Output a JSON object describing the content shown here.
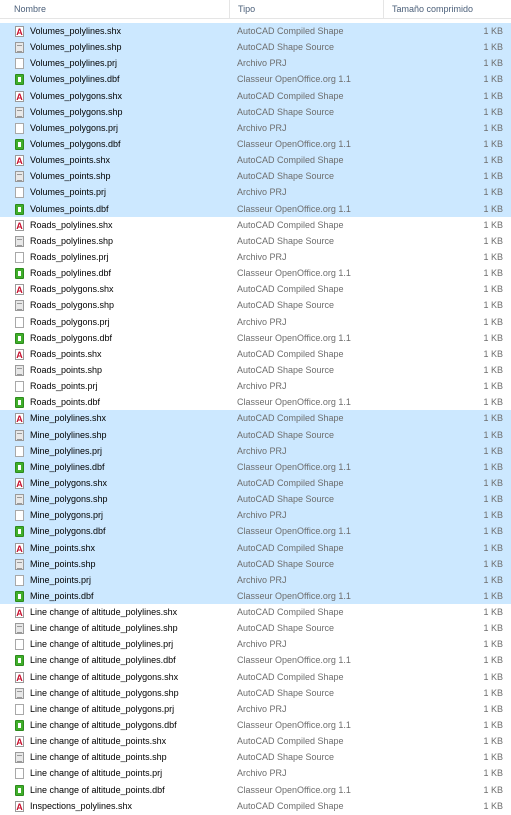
{
  "columns": {
    "name": "Nombre",
    "type": "Tipo",
    "size": "Tamaño comprimido"
  },
  "files": [
    {
      "name": "Volumes_polylines.shx",
      "type": "AutoCAD Compiled Shape",
      "size": "1 KB",
      "icon": "shx",
      "selected": true
    },
    {
      "name": "Volumes_polylines.shp",
      "type": "AutoCAD Shape Source",
      "size": "1 KB",
      "icon": "shp",
      "selected": true
    },
    {
      "name": "Volumes_polylines.prj",
      "type": "Archivo PRJ",
      "size": "1 KB",
      "icon": "prj",
      "selected": true
    },
    {
      "name": "Volumes_polylines.dbf",
      "type": "Classeur OpenOffice.org 1.1",
      "size": "1 KB",
      "icon": "dbf",
      "selected": true
    },
    {
      "name": "Volumes_polygons.shx",
      "type": "AutoCAD Compiled Shape",
      "size": "1 KB",
      "icon": "shx",
      "selected": true
    },
    {
      "name": "Volumes_polygons.shp",
      "type": "AutoCAD Shape Source",
      "size": "1 KB",
      "icon": "shp",
      "selected": true
    },
    {
      "name": "Volumes_polygons.prj",
      "type": "Archivo PRJ",
      "size": "1 KB",
      "icon": "prj",
      "selected": true
    },
    {
      "name": "Volumes_polygons.dbf",
      "type": "Classeur OpenOffice.org 1.1",
      "size": "1 KB",
      "icon": "dbf",
      "selected": true
    },
    {
      "name": "Volumes_points.shx",
      "type": "AutoCAD Compiled Shape",
      "size": "1 KB",
      "icon": "shx",
      "selected": true
    },
    {
      "name": "Volumes_points.shp",
      "type": "AutoCAD Shape Source",
      "size": "1 KB",
      "icon": "shp",
      "selected": true
    },
    {
      "name": "Volumes_points.prj",
      "type": "Archivo PRJ",
      "size": "1 KB",
      "icon": "prj",
      "selected": true
    },
    {
      "name": "Volumes_points.dbf",
      "type": "Classeur OpenOffice.org 1.1",
      "size": "1 KB",
      "icon": "dbf",
      "selected": true
    },
    {
      "name": "Roads_polylines.shx",
      "type": "AutoCAD Compiled Shape",
      "size": "1 KB",
      "icon": "shx",
      "selected": false
    },
    {
      "name": "Roads_polylines.shp",
      "type": "AutoCAD Shape Source",
      "size": "1 KB",
      "icon": "shp",
      "selected": false
    },
    {
      "name": "Roads_polylines.prj",
      "type": "Archivo PRJ",
      "size": "1 KB",
      "icon": "prj",
      "selected": false
    },
    {
      "name": "Roads_polylines.dbf",
      "type": "Classeur OpenOffice.org 1.1",
      "size": "1 KB",
      "icon": "dbf",
      "selected": false
    },
    {
      "name": "Roads_polygons.shx",
      "type": "AutoCAD Compiled Shape",
      "size": "1 KB",
      "icon": "shx",
      "selected": false
    },
    {
      "name": "Roads_polygons.shp",
      "type": "AutoCAD Shape Source",
      "size": "1 KB",
      "icon": "shp",
      "selected": false
    },
    {
      "name": "Roads_polygons.prj",
      "type": "Archivo PRJ",
      "size": "1 KB",
      "icon": "prj",
      "selected": false
    },
    {
      "name": "Roads_polygons.dbf",
      "type": "Classeur OpenOffice.org 1.1",
      "size": "1 KB",
      "icon": "dbf",
      "selected": false
    },
    {
      "name": "Roads_points.shx",
      "type": "AutoCAD Compiled Shape",
      "size": "1 KB",
      "icon": "shx",
      "selected": false
    },
    {
      "name": "Roads_points.shp",
      "type": "AutoCAD Shape Source",
      "size": "1 KB",
      "icon": "shp",
      "selected": false
    },
    {
      "name": "Roads_points.prj",
      "type": "Archivo PRJ",
      "size": "1 KB",
      "icon": "prj",
      "selected": false
    },
    {
      "name": "Roads_points.dbf",
      "type": "Classeur OpenOffice.org 1.1",
      "size": "1 KB",
      "icon": "dbf",
      "selected": false
    },
    {
      "name": "Mine_polylines.shx",
      "type": "AutoCAD Compiled Shape",
      "size": "1 KB",
      "icon": "shx",
      "selected": true
    },
    {
      "name": "Mine_polylines.shp",
      "type": "AutoCAD Shape Source",
      "size": "1 KB",
      "icon": "shp",
      "selected": true
    },
    {
      "name": "Mine_polylines.prj",
      "type": "Archivo PRJ",
      "size": "1 KB",
      "icon": "prj",
      "selected": true
    },
    {
      "name": "Mine_polylines.dbf",
      "type": "Classeur OpenOffice.org 1.1",
      "size": "1 KB",
      "icon": "dbf",
      "selected": true
    },
    {
      "name": "Mine_polygons.shx",
      "type": "AutoCAD Compiled Shape",
      "size": "1 KB",
      "icon": "shx",
      "selected": true
    },
    {
      "name": "Mine_polygons.shp",
      "type": "AutoCAD Shape Source",
      "size": "1 KB",
      "icon": "shp",
      "selected": true
    },
    {
      "name": "Mine_polygons.prj",
      "type": "Archivo PRJ",
      "size": "1 KB",
      "icon": "prj",
      "selected": true
    },
    {
      "name": "Mine_polygons.dbf",
      "type": "Classeur OpenOffice.org 1.1",
      "size": "1 KB",
      "icon": "dbf",
      "selected": true
    },
    {
      "name": "Mine_points.shx",
      "type": "AutoCAD Compiled Shape",
      "size": "1 KB",
      "icon": "shx",
      "selected": true
    },
    {
      "name": "Mine_points.shp",
      "type": "AutoCAD Shape Source",
      "size": "1 KB",
      "icon": "shp",
      "selected": true
    },
    {
      "name": "Mine_points.prj",
      "type": "Archivo PRJ",
      "size": "1 KB",
      "icon": "prj",
      "selected": true
    },
    {
      "name": "Mine_points.dbf",
      "type": "Classeur OpenOffice.org 1.1",
      "size": "1 KB",
      "icon": "dbf",
      "selected": true
    },
    {
      "name": "Line change of altitude_polylines.shx",
      "type": "AutoCAD Compiled Shape",
      "size": "1 KB",
      "icon": "shx",
      "selected": false
    },
    {
      "name": "Line change of altitude_polylines.shp",
      "type": "AutoCAD Shape Source",
      "size": "1 KB",
      "icon": "shp",
      "selected": false
    },
    {
      "name": "Line change of altitude_polylines.prj",
      "type": "Archivo PRJ",
      "size": "1 KB",
      "icon": "prj",
      "selected": false
    },
    {
      "name": "Line change of altitude_polylines.dbf",
      "type": "Classeur OpenOffice.org 1.1",
      "size": "1 KB",
      "icon": "dbf",
      "selected": false
    },
    {
      "name": "Line change of altitude_polygons.shx",
      "type": "AutoCAD Compiled Shape",
      "size": "1 KB",
      "icon": "shx",
      "selected": false
    },
    {
      "name": "Line change of altitude_polygons.shp",
      "type": "AutoCAD Shape Source",
      "size": "1 KB",
      "icon": "shp",
      "selected": false
    },
    {
      "name": "Line change of altitude_polygons.prj",
      "type": "Archivo PRJ",
      "size": "1 KB",
      "icon": "prj",
      "selected": false
    },
    {
      "name": "Line change of altitude_polygons.dbf",
      "type": "Classeur OpenOffice.org 1.1",
      "size": "1 KB",
      "icon": "dbf",
      "selected": false
    },
    {
      "name": "Line change of altitude_points.shx",
      "type": "AutoCAD Compiled Shape",
      "size": "1 KB",
      "icon": "shx",
      "selected": false
    },
    {
      "name": "Line change of altitude_points.shp",
      "type": "AutoCAD Shape Source",
      "size": "1 KB",
      "icon": "shp",
      "selected": false
    },
    {
      "name": "Line change of altitude_points.prj",
      "type": "Archivo PRJ",
      "size": "1 KB",
      "icon": "prj",
      "selected": false
    },
    {
      "name": "Line change of altitude_points.dbf",
      "type": "Classeur OpenOffice.org 1.1",
      "size": "1 KB",
      "icon": "dbf",
      "selected": false
    },
    {
      "name": "Inspections_polylines.shx",
      "type": "AutoCAD Compiled Shape",
      "size": "1 KB",
      "icon": "shx",
      "selected": false
    }
  ],
  "colors": {
    "selection": "#cce8ff",
    "header_text": "#4c607a",
    "secondary_text": "#6d6d6d",
    "dbf_icon": "#3fae2a",
    "shx_icon": "#c8102e"
  }
}
